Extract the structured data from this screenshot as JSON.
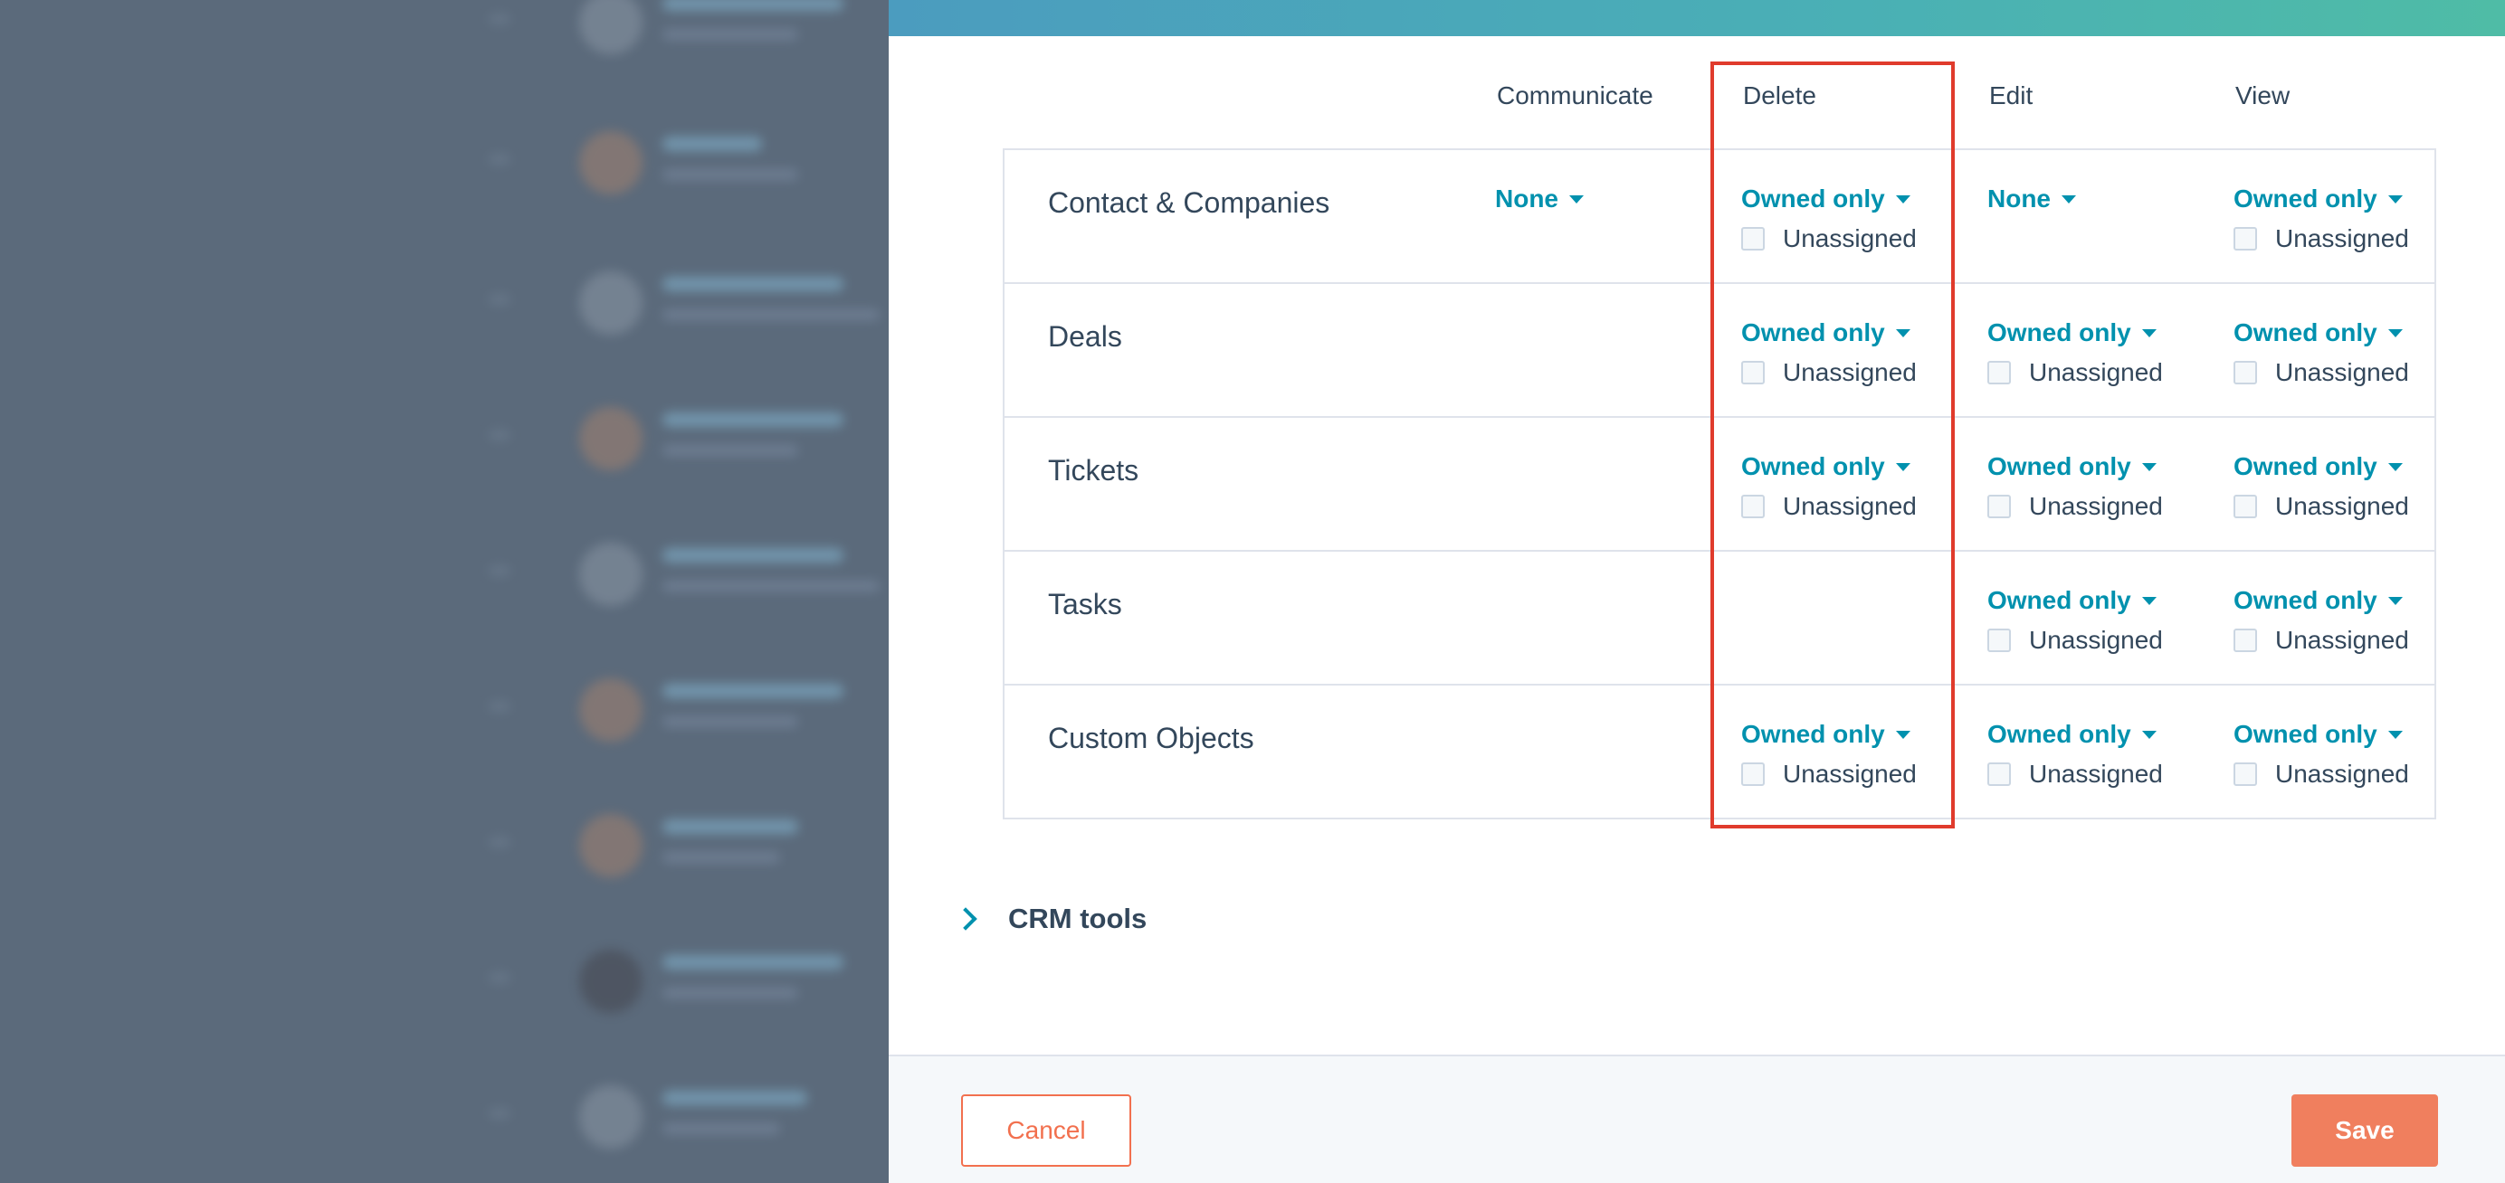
{
  "colors": {
    "accent": "#0091ae",
    "text": "#33475b",
    "border": "#dfe3eb",
    "cancel": "#f2704e",
    "save": "#f07f5e",
    "highlight": "#e03b2c"
  },
  "columns": {
    "communicate": "Communicate",
    "delete": "Delete",
    "edit": "Edit",
    "view": "View"
  },
  "rows": [
    {
      "label": "Contact & Companies",
      "communicate": {
        "value": "None"
      },
      "delete": {
        "value": "Owned only",
        "checkbox_label": "Unassigned"
      },
      "edit": {
        "value": "None"
      },
      "view": {
        "value": "Owned only",
        "checkbox_label": "Unassigned"
      }
    },
    {
      "label": "Deals",
      "delete": {
        "value": "Owned only",
        "checkbox_label": "Unassigned"
      },
      "edit": {
        "value": "Owned only",
        "checkbox_label": "Unassigned"
      },
      "view": {
        "value": "Owned only",
        "checkbox_label": "Unassigned"
      }
    },
    {
      "label": "Tickets",
      "delete": {
        "value": "Owned only",
        "checkbox_label": "Unassigned"
      },
      "edit": {
        "value": "Owned only",
        "checkbox_label": "Unassigned"
      },
      "view": {
        "value": "Owned only",
        "checkbox_label": "Unassigned"
      }
    },
    {
      "label": "Tasks",
      "edit": {
        "value": "Owned only",
        "checkbox_label": "Unassigned"
      },
      "view": {
        "value": "Owned only",
        "checkbox_label": "Unassigned"
      }
    },
    {
      "label": "Custom Objects",
      "delete": {
        "value": "Owned only",
        "checkbox_label": "Unassigned"
      },
      "edit": {
        "value": "Owned only",
        "checkbox_label": "Unassigned"
      },
      "view": {
        "value": "Owned only",
        "checkbox_label": "Unassigned"
      }
    }
  ],
  "crm_tools": {
    "label": "CRM tools",
    "icon": "chevron-right-icon"
  },
  "footer": {
    "cancel_label": "Cancel",
    "save_label": "Save"
  }
}
